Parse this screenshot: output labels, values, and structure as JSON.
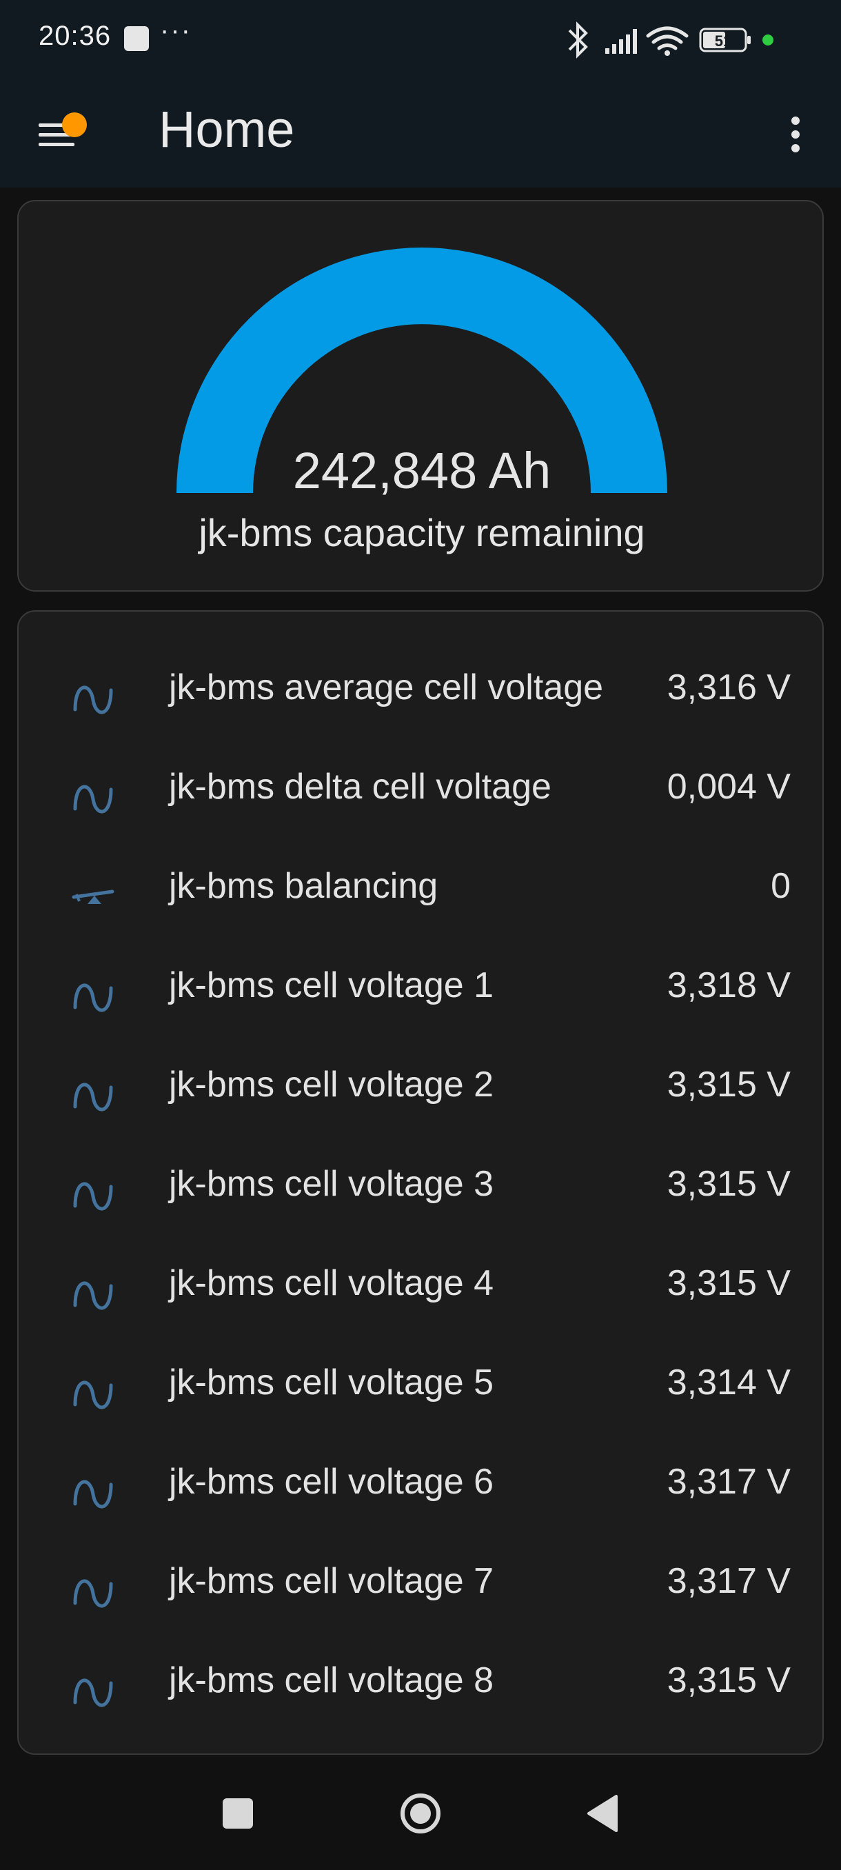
{
  "status_bar": {
    "time": "20:36",
    "dots": "···",
    "battery_level": "51",
    "icons": [
      "bluetooth-icon",
      "signal-icon",
      "wifi-icon",
      "battery-icon",
      "active-dot-icon"
    ]
  },
  "header": {
    "title": "Home",
    "menu_icon": "menu-icon",
    "notification_color": "#ff9800",
    "overflow_icon": "more-vertical-icon"
  },
  "gauge": {
    "value_text": "242,848 Ah",
    "label": "jk-bms capacity remaining",
    "fill_fraction": 1.0,
    "color": "#039be5"
  },
  "entities": [
    {
      "icon": "sine-wave-icon",
      "label": "jk-bms average cell voltage",
      "value": "3,316 V"
    },
    {
      "icon": "sine-wave-icon",
      "label": "jk-bms delta cell voltage",
      "value": "0,004 V"
    },
    {
      "icon": "seesaw-icon",
      "label": "jk-bms balancing",
      "value": "0"
    },
    {
      "icon": "sine-wave-icon",
      "label": "jk-bms cell voltage 1",
      "value": "3,318 V"
    },
    {
      "icon": "sine-wave-icon",
      "label": "jk-bms cell voltage 2",
      "value": "3,315 V"
    },
    {
      "icon": "sine-wave-icon",
      "label": "jk-bms cell voltage 3",
      "value": "3,315 V"
    },
    {
      "icon": "sine-wave-icon",
      "label": "jk-bms cell voltage 4",
      "value": "3,315 V"
    },
    {
      "icon": "sine-wave-icon",
      "label": "jk-bms cell voltage 5",
      "value": "3,314 V"
    },
    {
      "icon": "sine-wave-icon",
      "label": "jk-bms cell voltage 6",
      "value": "3,317 V"
    },
    {
      "icon": "sine-wave-icon",
      "label": "jk-bms cell voltage 7",
      "value": "3,317 V"
    },
    {
      "icon": "sine-wave-icon",
      "label": "jk-bms cell voltage 8",
      "value": "3,315 V"
    }
  ],
  "nav_bar": {
    "recents_icon": "recents-square-icon",
    "home_icon": "home-circle-icon",
    "back_icon": "back-triangle-icon"
  },
  "colors": {
    "background": "#111111",
    "header": "#101a20",
    "card": "#1c1c1c",
    "icon": "#44739e",
    "accent": "#039be5"
  }
}
